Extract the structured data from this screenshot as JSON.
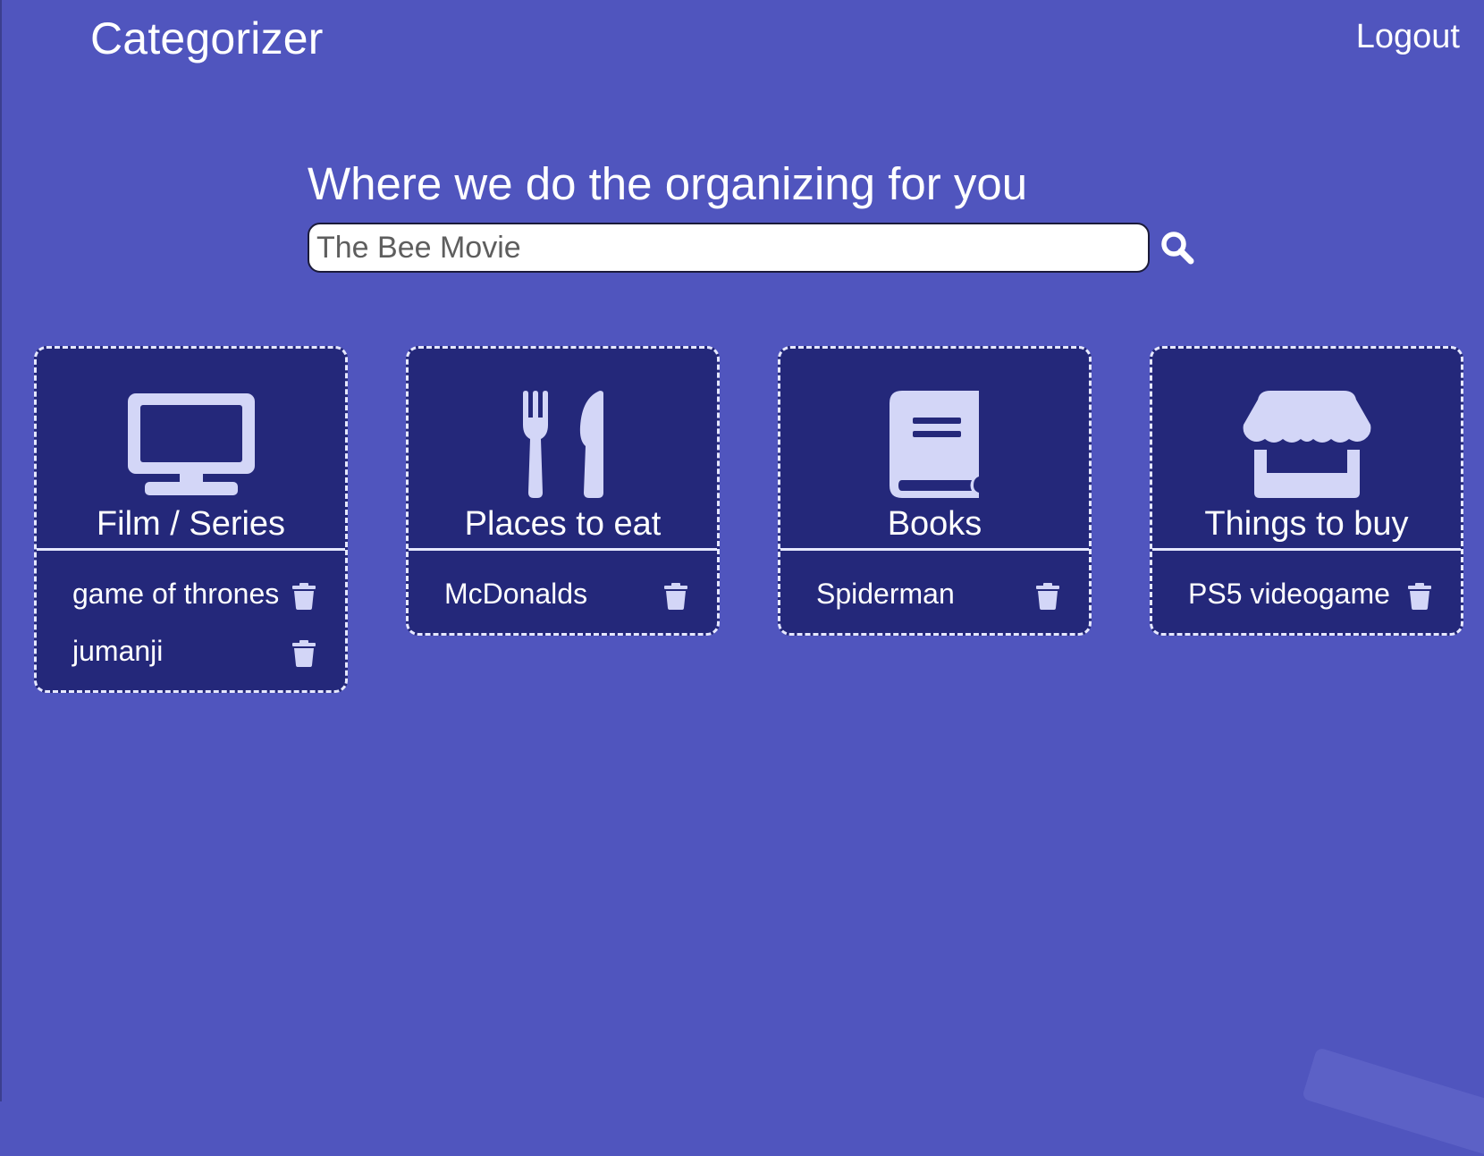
{
  "header": {
    "app_title": "Categorizer",
    "logout_label": "Logout"
  },
  "hero": {
    "tagline": "Where we do the organizing for you"
  },
  "search": {
    "value": "",
    "placeholder": "The Bee Movie",
    "button_icon": "search-icon"
  },
  "colors": {
    "background": "#5055be",
    "card_background": "#24287a",
    "icon_color": "#d3d6f7",
    "text": "#ffffff"
  },
  "categories": [
    {
      "title": "Film / Series",
      "icon": "tv-monitor-icon",
      "items": [
        {
          "label": "game of thrones"
        },
        {
          "label": "jumanji"
        }
      ]
    },
    {
      "title": "Places to eat",
      "icon": "fork-knife-icon",
      "items": [
        {
          "label": "McDonalds"
        }
      ]
    },
    {
      "title": "Books",
      "icon": "book-icon",
      "items": [
        {
          "label": "Spiderman"
        }
      ]
    },
    {
      "title": "Things to buy",
      "icon": "store-icon",
      "items": [
        {
          "label": "PS5 videogame"
        }
      ]
    }
  ]
}
